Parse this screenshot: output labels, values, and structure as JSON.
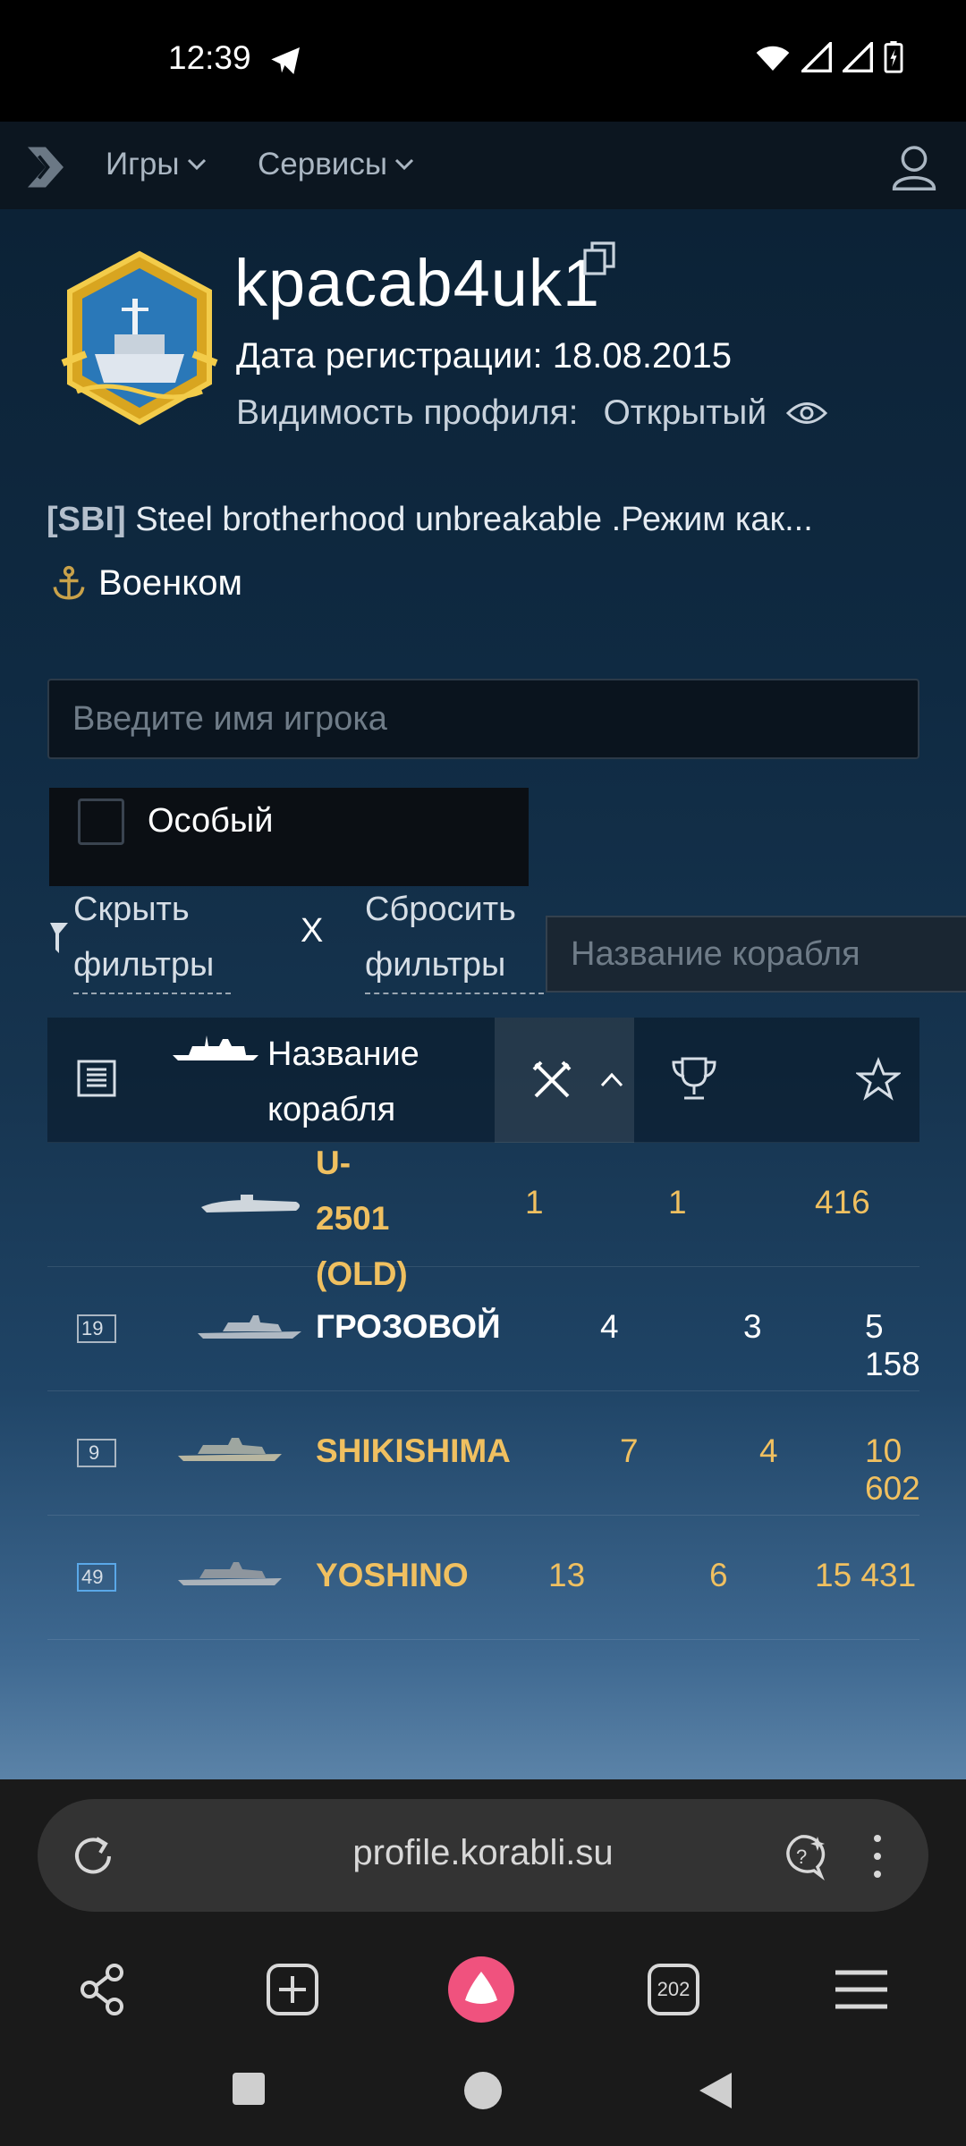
{
  "status_bar": {
    "time": "12:39"
  },
  "nav": {
    "games_label": "Игры",
    "services_label": "Сервисы"
  },
  "profile": {
    "username": "kpacab4uk1",
    "reg_date": "Дата регистрации: 18.08.2015",
    "visibility_label": "Видимость профиля:",
    "visibility_value": "Открытый",
    "clan_tag": "[SBI]",
    "clan_desc": "Steel brotherhood unbreakable .Режим как...",
    "rank": "Военком"
  },
  "search": {
    "player_placeholder": "Введите имя игрока",
    "ship_placeholder": "Название корабля"
  },
  "filters": {
    "special_label": "Особый",
    "hide_label": "Скрыть фильтры",
    "clear_label": "X",
    "reset_label": "Сбросить фильтры"
  },
  "table": {
    "name_header": "Название корабля",
    "rows": [
      {
        "tier": "",
        "name": "U-2501 (OLD)",
        "battles": "1",
        "wins": "1",
        "exp": "416",
        "premium": true
      },
      {
        "tier": "19",
        "name": "ГРОЗОВОЙ",
        "battles": "4",
        "wins": "3",
        "exp": "5 158",
        "premium": false
      },
      {
        "tier": "9",
        "name": "SHIKISHIMA",
        "battles": "7",
        "wins": "4",
        "exp": "10 602",
        "premium": true
      },
      {
        "tier": "49",
        "name": "YOSHINO",
        "battles": "13",
        "wins": "6",
        "exp": "15 431",
        "premium": true
      }
    ]
  },
  "browser": {
    "url": "profile.korabli.su",
    "tabs_count": "202"
  },
  "colors": {
    "accent_gold": "#f0c060",
    "nav_bg": "#0c1620",
    "page_bg": "#0f2a42"
  }
}
